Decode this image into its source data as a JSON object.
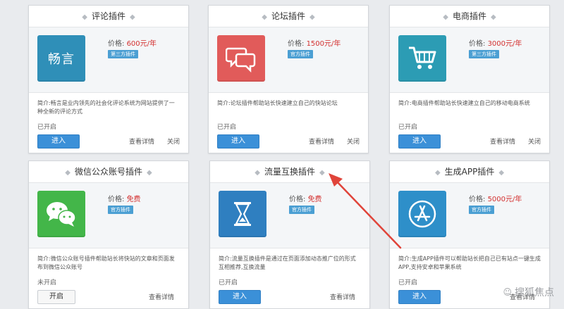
{
  "plugins": [
    {
      "title": "评论插件",
      "price_label": "价格:",
      "price_value": "600元/年",
      "badge": "第三方插件",
      "icon_text": "畅言",
      "desc": "简介:畅言是业内领先的社会化评论系统为网站提供了一种全新的评论方式",
      "status": "已开启",
      "primary_button": "进入",
      "detail_link": "查看详情",
      "close_link": "关闭"
    },
    {
      "title": "论坛插件",
      "price_label": "价格:",
      "price_value": "1500元/年",
      "badge": "官方插件",
      "desc": "简介:论坛插件帮助站长快速建立自己的快站论坛",
      "status": "已开启",
      "primary_button": "进入",
      "detail_link": "查看详情",
      "close_link": "关闭"
    },
    {
      "title": "电商插件",
      "price_label": "价格:",
      "price_value": "3000元/年",
      "badge": "第三方插件",
      "desc": "简介:电商插件帮助站长快速建立自己的移动电商系统",
      "status": "已开启",
      "primary_button": "进入",
      "detail_link": "查看详情",
      "close_link": "关闭"
    },
    {
      "title": "微信公众账号插件",
      "price_label": "价格:",
      "price_value": "免费",
      "badge": "官方插件",
      "desc": "简介:微信公众账号插件帮助站长将快站的文章和页面发布到微信公众账号",
      "status": "未开启",
      "primary_button": "开启",
      "detail_link": "查看详情"
    },
    {
      "title": "流量互换插件",
      "price_label": "价格:",
      "price_value": "免费",
      "badge": "官方插件",
      "desc": "简介:流量互换插件是通过在页面添加动态推广位的形式互相推荐,互换流量",
      "status": "已开启",
      "primary_button": "进入",
      "detail_link": "查看详情"
    },
    {
      "title": "生成APP插件",
      "price_label": "价格:",
      "price_value": "5000元/年",
      "badge": "官方插件",
      "desc": "简介:生成APP插件可以帮助站长把自己已有站点一键生成APP,支持安卓和苹果系统",
      "status": "已开启",
      "primary_button": "进入",
      "detail_link": "查看详情"
    }
  ],
  "watermark": "搜狐焦点",
  "colors": {
    "price": "#d3302f",
    "primary_button": "#3b90d8",
    "badge": "#4b9fd3",
    "arrow": "#e0443a"
  }
}
